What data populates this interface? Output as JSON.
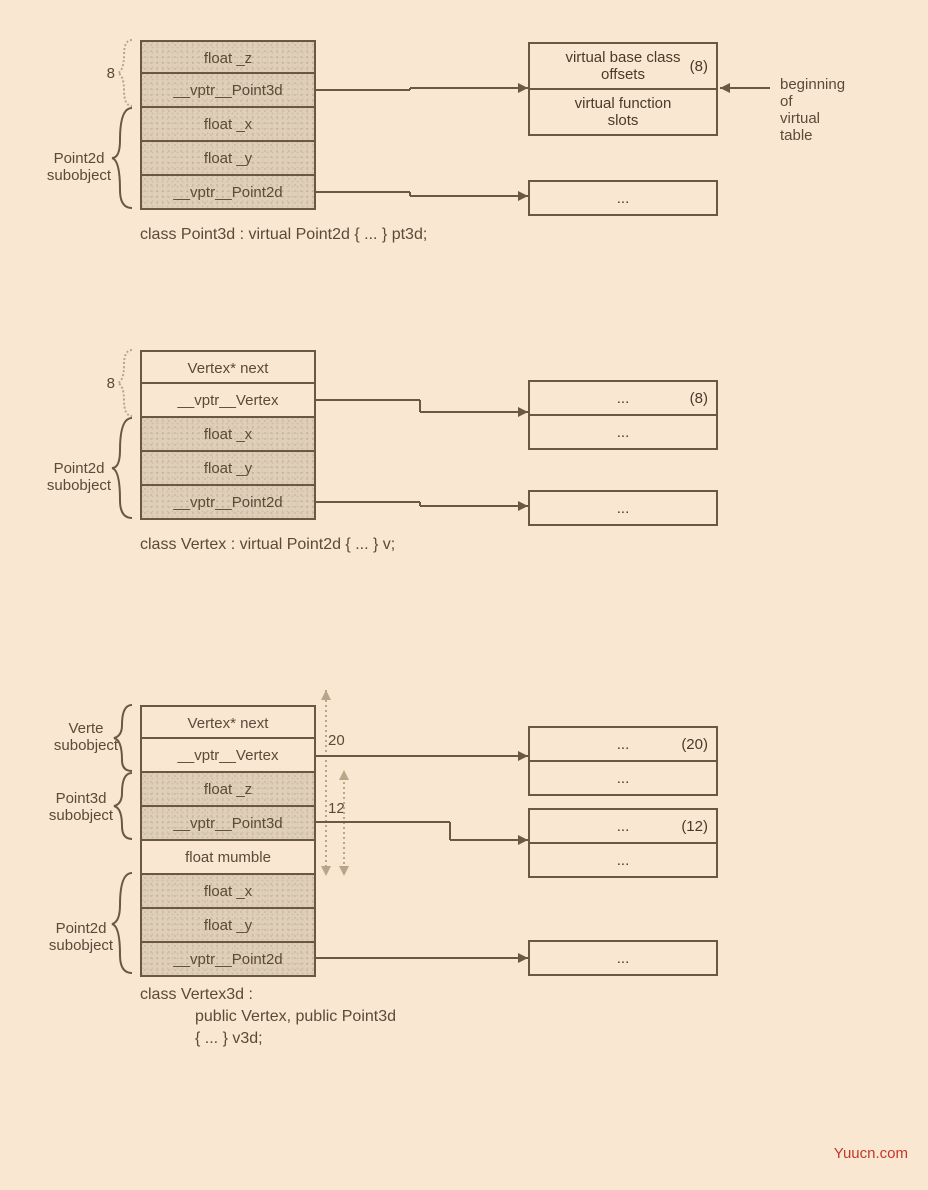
{
  "fig1": {
    "rows": [
      "float _z",
      "__vptr__Point3d",
      "float _x",
      "float _y",
      "__vptr__Point2d"
    ],
    "size_label": "8",
    "sub_label": "Point2d\nsubobject",
    "caption": "class Point3d : virtual Point2d { ... } pt3d;",
    "vt1a": "virtual base class\noffsets",
    "vt1a_off": "(8)",
    "vt1b": "virtual function\nslots",
    "vt2": "...",
    "note": "beginning\nof\nvirtual\ntable"
  },
  "fig2": {
    "rows": [
      "Vertex* next",
      "__vptr__Vertex",
      "float _x",
      "float _y",
      "__vptr__Point2d"
    ],
    "size_label": "8",
    "sub_label": "Point2d\nsubobject",
    "caption": "class Vertex : virtual Point2d { ... } v;",
    "vt1a": "...",
    "vt1a_off": "(8)",
    "vt1b": "...",
    "vt2": "..."
  },
  "fig3": {
    "rows": [
      "Vertex* next",
      "__vptr__Vertex",
      "float _z",
      "__vptr__Point3d",
      "float mumble",
      "float _x",
      "float _y",
      "__vptr__Point2d"
    ],
    "sub_a": "Verte\nsubobject",
    "sub_b": "Point3d\nsubobject",
    "sub_c": "Point2d\nsubobject",
    "off_a": "20",
    "off_b": "12",
    "vt1a": "...",
    "vt1a_off": "(20)",
    "vt1b": "...",
    "vt2a": "...",
    "vt2a_off": "(12)",
    "vt2b": "...",
    "vt3": "...",
    "caption1": "class Vertex3d :",
    "caption2": "public Vertex, public Point3d",
    "caption3": "{ ... } v3d;"
  },
  "watermark": "Yuucn.com"
}
